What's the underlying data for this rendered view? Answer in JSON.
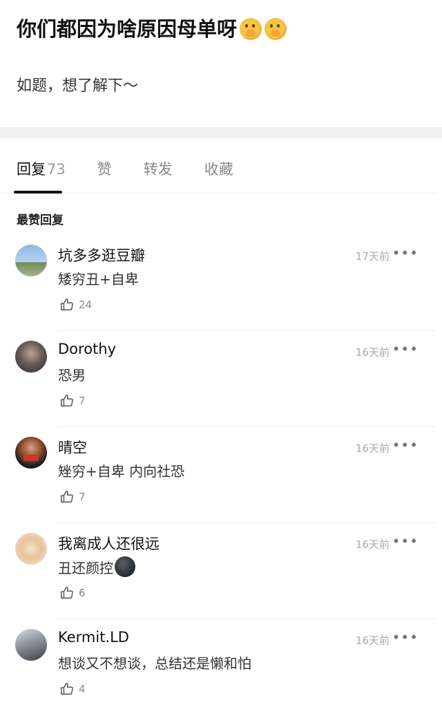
{
  "post": {
    "title": "你们都因为啥原因母单呀",
    "body": "如题，想了解下～"
  },
  "tabs": [
    {
      "label": "回复",
      "count": "73"
    },
    {
      "label": "赞"
    },
    {
      "label": "转发"
    },
    {
      "label": "收藏"
    }
  ],
  "section_label": "最赞回复",
  "comments": [
    {
      "author": "坑多多逛豆瓣",
      "text": "矮穷丑+自卑",
      "likes": "24",
      "time": "17天前"
    },
    {
      "author": "Dorothy",
      "text": "恐男",
      "likes": "7",
      "time": "16天前"
    },
    {
      "author": "晴空",
      "text": "矬穷+自卑 内向社恐",
      "likes": "7",
      "time": "16天前"
    },
    {
      "author": "我离成人还很远",
      "text": "丑还颜控",
      "likes": "6",
      "time": "16天前"
    },
    {
      "author": "Kermit.LD",
      "text": "想谈又不想谈，总结还是懒和怕",
      "likes": "4",
      "time": "16天前"
    }
  ],
  "more_label": "•••",
  "icons": {
    "like": "thumbs-up-icon",
    "more": "more-dots-icon",
    "title_emoji": "hand-over-mouth-emoji",
    "comment_emoji": "dark-face-emoji"
  }
}
